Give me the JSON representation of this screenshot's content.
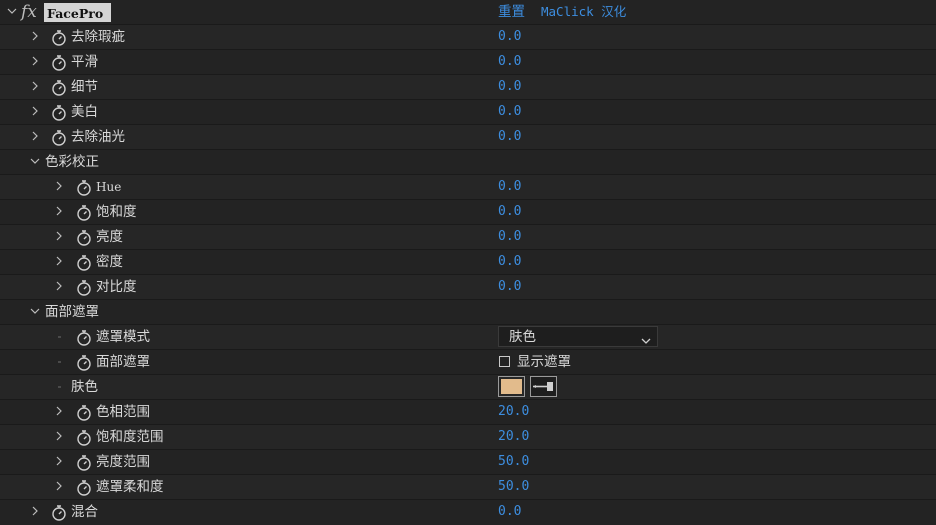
{
  "effect": {
    "fx_symbol": "fx",
    "name": "FacePro",
    "reset_label": "重置",
    "credit_label": "MaClick 汉化"
  },
  "params": {
    "blemish": {
      "label": "去除瑕疵",
      "value": "0.0"
    },
    "smooth": {
      "label": "平滑",
      "value": "0.0"
    },
    "detail": {
      "label": "细节",
      "value": "0.0"
    },
    "whiten": {
      "label": "美白",
      "value": "0.0"
    },
    "deshine": {
      "label": "去除油光",
      "value": "0.0"
    }
  },
  "color_correction": {
    "label": "色彩校正",
    "hue": {
      "label": "Hue",
      "value": "0.0"
    },
    "saturation": {
      "label": "饱和度",
      "value": "0.0"
    },
    "brightness": {
      "label": "亮度",
      "value": "0.0"
    },
    "density": {
      "label": "密度",
      "value": "0.0"
    },
    "contrast": {
      "label": "对比度",
      "value": "0.0"
    }
  },
  "face_mask": {
    "label": "面部遮罩",
    "mask_mode": {
      "label": "遮罩模式",
      "selected": "肤色"
    },
    "face_mask": {
      "label": "面部遮罩",
      "checkbox_label": "显示遮罩",
      "checked": false
    },
    "skin_color": {
      "label": "肤色",
      "color": "#e2bb8c"
    },
    "hue_range": {
      "label": "色相范围",
      "value": "20.0"
    },
    "sat_range": {
      "label": "饱和度范围",
      "value": "20.0"
    },
    "bright_range": {
      "label": "亮度范围",
      "value": "50.0"
    },
    "softness": {
      "label": "遮罩柔和度",
      "value": "50.0"
    }
  },
  "blend": {
    "label": "混合",
    "value": "0.0"
  },
  "colors": {
    "accent": "#3d8ee0",
    "background": "#232323",
    "text": "#d9d9d9"
  },
  "icons": {
    "twirl_closed": "chevron-right-icon",
    "twirl_open": "chevron-down-icon",
    "stopwatch": "stopwatch-icon",
    "eyedropper": "eyedropper-icon"
  }
}
